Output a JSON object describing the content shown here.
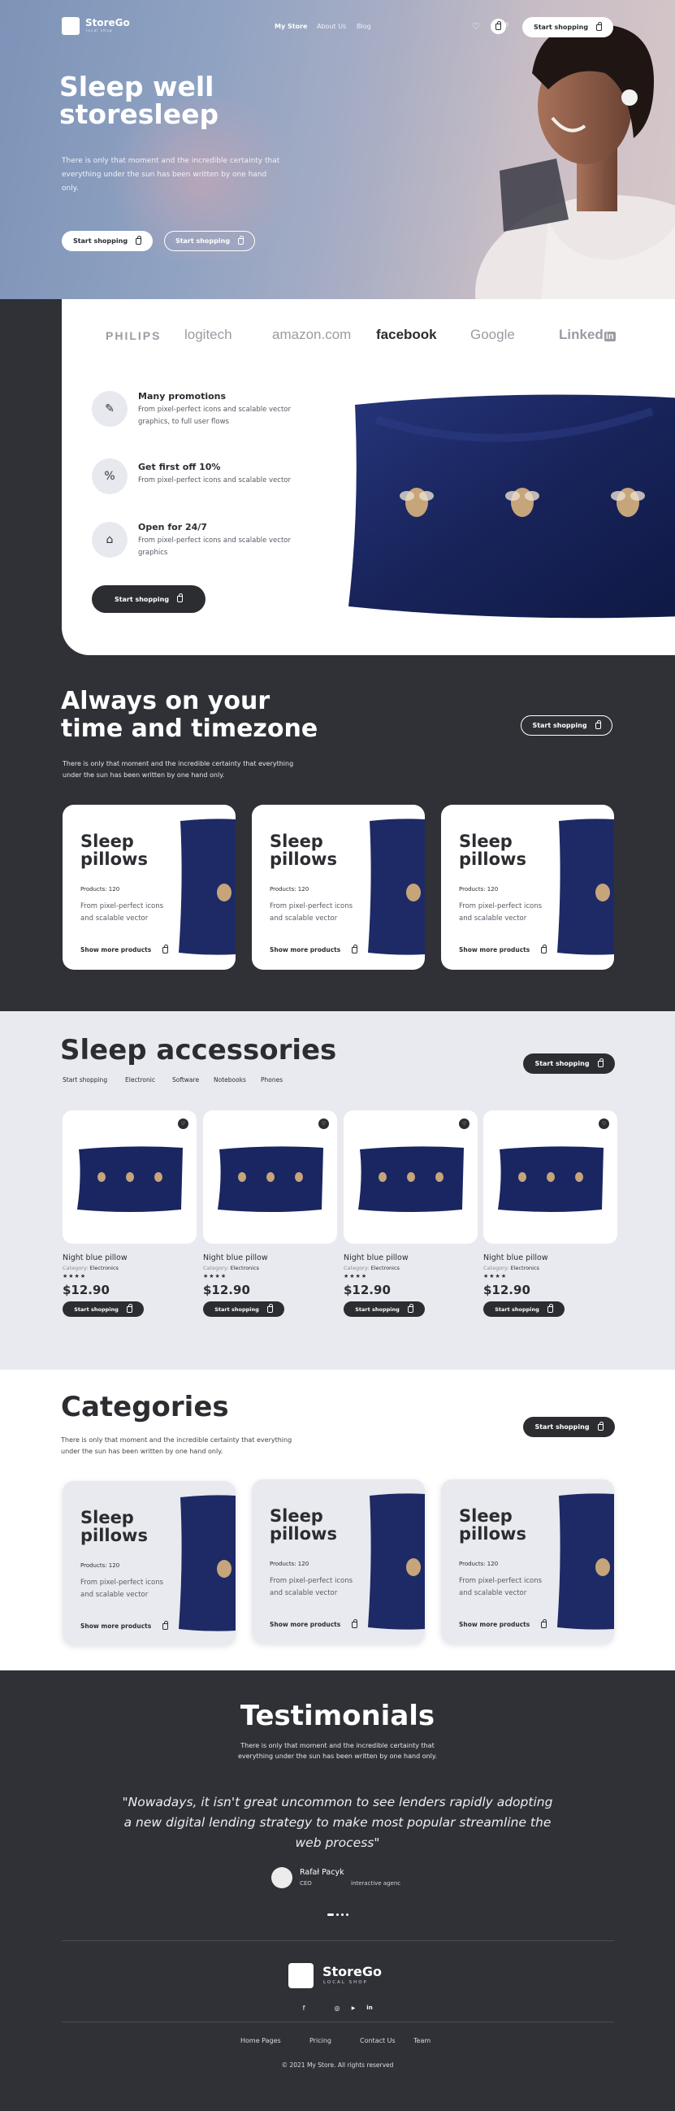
{
  "header": {
    "logo": "StoreGo",
    "logo_sub": "local shop",
    "nav": [
      "My Store",
      "About Us",
      "Blog"
    ],
    "cart_count": "0",
    "cta": "Start shopping"
  },
  "hero": {
    "title_line1": "Sleep well",
    "title_line2": "storesleep",
    "text": "There is only that moment and the incredible certainty that everything under the sun has been written by one hand only.",
    "btn1": "Start shopping",
    "btn2": "Start shopping"
  },
  "brands": [
    "PHILIPS",
    "logitech",
    "amazon.com",
    "facebook",
    "Google",
    "Linked"
  ],
  "features": [
    {
      "title": "Many promotions",
      "text": "From pixel-perfect icons and scalable vector graphics, to full user flows",
      "icon": "pencil-icon"
    },
    {
      "title": "Get first off 10%",
      "text": "From pixel-perfect icons and scalable vector",
      "icon": "percent-icon"
    },
    {
      "title": "Open for 24/7",
      "text": "From pixel-perfect icons and scalable vector graphics",
      "icon": "store-icon"
    }
  ],
  "features_cta": "Start shopping",
  "timezone": {
    "title_line1": "Always on your",
    "title_line2": "time and timezone",
    "text": "There is only that moment and the incredible certainty that everything under the sun has been written by one hand only.",
    "cta": "Start shopping",
    "cards": [
      {
        "title_line1": "Sleep",
        "title_line2": "pillows",
        "products": "Products: 120",
        "text": "From pixel-perfect icons and scalable vector",
        "more": "Show more products"
      },
      {
        "title_line1": "Sleep",
        "title_line2": "pillows",
        "products": "Products: 120",
        "text": "From pixel-perfect icons and scalable vector",
        "more": "Show more products"
      },
      {
        "title_line1": "Sleep",
        "title_line2": "pillows",
        "products": "Products: 120",
        "text": "From pixel-perfect icons and scalable vector",
        "more": "Show more products"
      }
    ]
  },
  "accessories": {
    "title": "Sleep accessories",
    "tabs": [
      "Start shopping",
      "Electronic",
      "Software",
      "Notebooks",
      "Phones"
    ],
    "cta": "Start shopping",
    "products": [
      {
        "name": "Night blue pillow",
        "category_label": "Category:",
        "category": "Electronics",
        "stars": "★★★★",
        "price": "$12.90",
        "btn": "Start shopping"
      },
      {
        "name": "Night blue pillow",
        "category_label": "Category:",
        "category": "Electronics",
        "stars": "★★★★",
        "price": "$12.90",
        "btn": "Start shopping"
      },
      {
        "name": "Night blue pillow",
        "category_label": "Category:",
        "category": "Electronics",
        "stars": "★★★★",
        "price": "$12.90",
        "btn": "Start shopping"
      },
      {
        "name": "Night blue pillow",
        "category_label": "Category:",
        "category": "Electronics",
        "stars": "★★★★",
        "price": "$12.90",
        "btn": "Start shopping"
      }
    ]
  },
  "categories": {
    "title": "Categories",
    "text": "There is only that moment and the incredible certainty that everything under the sun has been written by one hand only.",
    "cta": "Start shopping",
    "cards": [
      {
        "title_line1": "Sleep",
        "title_line2": "pillows",
        "products": "Products: 120",
        "text": "From pixel-perfect icons and scalable vector",
        "more": "Show more products"
      },
      {
        "title_line1": "Sleep",
        "title_line2": "pillows",
        "products": "Products: 120",
        "text": "From pixel-perfect icons and scalable vector",
        "more": "Show more products"
      },
      {
        "title_line1": "Sleep",
        "title_line2": "pillows",
        "products": "Products: 120",
        "text": "From pixel-perfect icons and scalable vector",
        "more": "Show more products"
      }
    ]
  },
  "testimonials": {
    "title": "Testimonials",
    "text": "There is only that moment and the incredible certainty that everything under the sun has been written by one hand only.",
    "quote_line1": "\"Nowadays, it isn't great uncommon to see lenders rapidly adopting",
    "quote_line2": "a new digital lending strategy to make most  popular streamline the",
    "quote_line3": "web process\"",
    "author": "Rafał Pacyk",
    "role": "CEO",
    "company": "interactive agenc"
  },
  "footer": {
    "logo": "StoreGo",
    "logo_sub": "LOCAL SHOP",
    "links": [
      "Home Pages",
      "Pricing",
      "Contact Us",
      "Team"
    ],
    "copyright": "© 2021 My Store. All rights reserved",
    "social": [
      "f",
      "◎",
      "▶",
      "in"
    ]
  },
  "colors": {
    "dark": "#2f3136",
    "light": "#e8eaef",
    "navy": "#1c2a63"
  }
}
